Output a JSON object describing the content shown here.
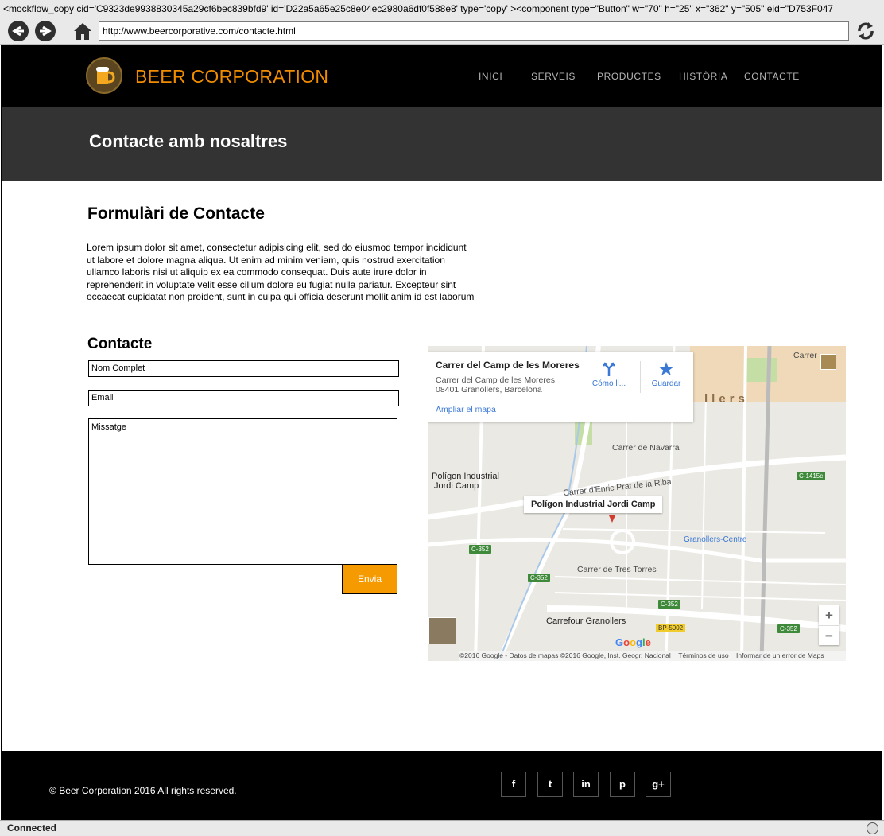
{
  "browser": {
    "code_strip": "<mockflow_copy cid='C9323de9938830345a29cf6bec839bfd9' id='D22a5a65e25c8e04ec2980a6df0f588e8' type='copy' ><component type=\"Button\" w=\"70\" h=\"25\" x=\"362\" y=\"505\" eid=\"D753F047",
    "url": "http://www.beercorporative.com/contacte.html",
    "status": "Connected"
  },
  "header": {
    "brand": "BEER CORPORATION",
    "nav": [
      "INICI",
      "SERVEIS",
      "PRODUCTES",
      "HISTÒRIA",
      "CONTACTE"
    ]
  },
  "hero": {
    "title": "Contacte amb nosaltres"
  },
  "form_section": {
    "heading": "Formulàri de Contacte",
    "intro": "Lorem ipsum dolor sit amet, consectetur adipisicing elit, sed do eiusmod tempor incididunt ut labore et dolore magna aliqua. Ut enim ad minim veniam, quis nostrud exercitation ullamco laboris nisi ut aliquip ex ea commodo consequat. Duis aute irure dolor in reprehenderit in voluptate velit esse cillum dolore eu fugiat nulla pariatur. Excepteur sint occaecat cupidatat non proident, sunt in culpa qui officia deserunt mollit anim id est laborum",
    "contact_heading": "Contacte",
    "name_placeholder": "Nom Complet",
    "email_placeholder": "Email",
    "message_placeholder": "Missatge",
    "send_label": "Envia"
  },
  "map": {
    "card_title": "Carrer del Camp de les Moreres",
    "card_address_line1": "Carrer del Camp de les Moreres,",
    "card_address_line2": "08401 Granollers, Barcelona",
    "card_link": "Ampliar el mapa",
    "directions_label": "Cómo ll...",
    "save_label": "Guardar",
    "pin_label": "Polígon Industrial Jordi Camp",
    "labels": {
      "carrer_navarra": "Carrer de Navarra",
      "poligon": "Polígon Industrial",
      "jordi_camp": "Jordi Camp",
      "enric_prat": "Carrer d'Enric Prat de la Riba",
      "tres_torres": "Carrer de Tres Torres",
      "carrefour": "Carrefour Granollers",
      "granollers_centre": "Granollers-Centre",
      "city": "llers",
      "carrer_top": "Carrer"
    },
    "badges": {
      "c352_a": "C-352",
      "c352_b": "C-352",
      "c352_c": "C-352",
      "c352_d": "C-352",
      "c1415": "C-1415c",
      "bp5002": "BP-5002"
    },
    "google": "Google",
    "footer_copy": "©2016 Google - Datos de mapas ©2016 Google, Inst. Geogr. Nacional",
    "footer_terms": "Términos de uso",
    "footer_report": "Informar de un error de Maps",
    "zoom_in": "+",
    "zoom_out": "−"
  },
  "footer": {
    "copyright": "Beer Corporation 2016 All rights reserved.",
    "social": [
      "f",
      "t",
      "in",
      "p",
      "g+"
    ]
  },
  "colors": {
    "brand_orange": "#f08c00",
    "button_orange": "#f59a00",
    "header_bg": "#000000",
    "hero_bg": "#333333"
  }
}
